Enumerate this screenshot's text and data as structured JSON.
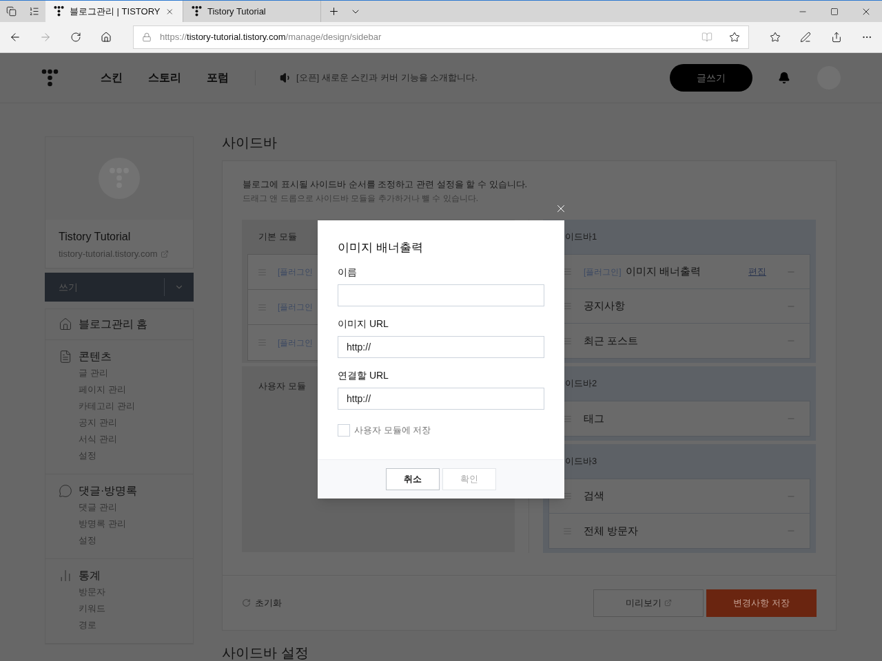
{
  "browser": {
    "tabs": [
      {
        "title": "블로그관리 | TISTORY",
        "selected": true
      },
      {
        "title": "Tistory Tutorial",
        "selected": false
      }
    ],
    "address": {
      "scheme": "https://",
      "host": "tistory-tutorial.tistory.com",
      "path": "/manage/design/sidebar"
    }
  },
  "header": {
    "nav": [
      "스킨",
      "스토리",
      "포럼"
    ],
    "notice": "[오픈] 새로운 스킨과 커버 기능을 소개합니다.",
    "write_button": "글쓰기"
  },
  "sidebar": {
    "blog": {
      "title": "Tistory Tutorial",
      "url": "tistory-tutorial.tistory.com"
    },
    "write_button": "쓰기",
    "menu": [
      {
        "label": "블로그관리 홈"
      },
      {
        "label": "콘텐츠",
        "children": [
          "글 관리",
          "페이지 관리",
          "카테고리 관리",
          "공지 관리",
          "서식 관리",
          "설정"
        ]
      },
      {
        "label": "댓글·방명록",
        "children": [
          "댓글 관리",
          "방명록 관리",
          "설정"
        ]
      },
      {
        "label": "통계",
        "children": [
          "방문자",
          "키워드",
          "경로"
        ]
      }
    ]
  },
  "main": {
    "title": "사이드바",
    "description": [
      "블로그에 표시될 사이드바 순서를 조정하고 관련 설정을 할 수 있습니다.",
      "드래그 앤 드롭으로 사이드바 모듈을 추가하거나 뺄 수 있습니다."
    ],
    "basic_modules": {
      "title": "기본 모듈",
      "items": [
        "[플러그인",
        "[플러그인",
        "[플러그인"
      ]
    },
    "user_modules": {
      "title": "사용자 모듈"
    },
    "sidebars": [
      {
        "title": "이드바1",
        "items": [
          {
            "tag": "[플러그인]",
            "name": "이미지 배너출력",
            "action": "편집"
          },
          {
            "name": "공지사항"
          },
          {
            "name": "최근 포스트"
          }
        ]
      },
      {
        "title": "이드바2",
        "items": [
          {
            "name": "태그"
          }
        ]
      },
      {
        "title": "이드바3",
        "items": [
          {
            "name": "검색"
          },
          {
            "name": "전체 방문자"
          }
        ]
      }
    ],
    "reset": "초기화",
    "preview": "미리보기",
    "save": "변경사항 저장",
    "next_section_title": "사이드바 설정"
  },
  "modal": {
    "title": "이미지 배너출력",
    "fields": [
      {
        "label": "이름"
      },
      {
        "label": "이미지 URL",
        "value": "http://"
      },
      {
        "label": "연결할 URL",
        "value": "http://"
      }
    ],
    "checkbox": {
      "label": "사용자 모듈에 저장",
      "checked": false
    },
    "buttons": [
      {
        "label": "취소",
        "disabled": false
      },
      {
        "label": "확인",
        "disabled": true
      }
    ]
  }
}
